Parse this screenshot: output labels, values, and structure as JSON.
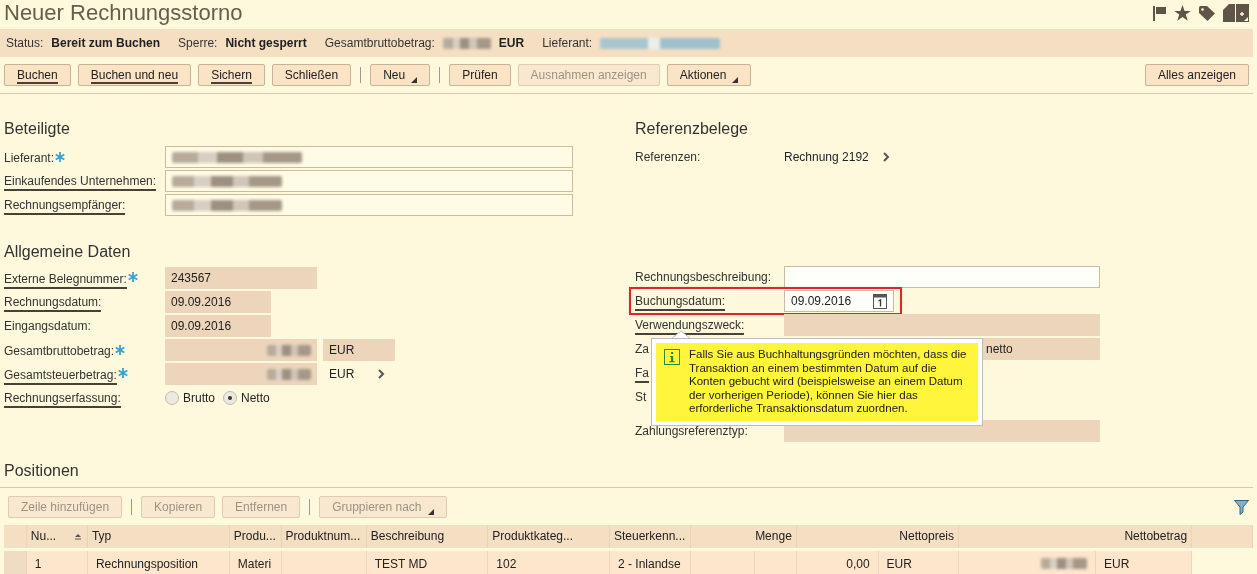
{
  "title": "Neuer Rechnungsstorno",
  "status_bar": [
    {
      "label": "Status:",
      "value": "Bereit zum Buchen",
      "blurred": false
    },
    {
      "label": "Sperre:",
      "value": "Nicht gesperrt",
      "blurred": false
    },
    {
      "label": "Gesamtbruttobetrag:",
      "value": "EUR",
      "blurred": true
    },
    {
      "label": "Lieferant:",
      "blurred": true
    }
  ],
  "toolbar": [
    {
      "kind": "button",
      "label": "Buchen",
      "underlined": true,
      "disabled": false
    },
    {
      "kind": "button",
      "label": "Buchen und neu",
      "underlined": true,
      "disabled": false
    },
    {
      "kind": "button",
      "label": "Sichern",
      "underlined": true,
      "disabled": false
    },
    {
      "kind": "button",
      "label": "Schließen",
      "underlined": false,
      "disabled": false
    },
    {
      "kind": "separator"
    },
    {
      "kind": "menu",
      "label": "Neu",
      "underlined": false,
      "disabled": false
    },
    {
      "kind": "separator"
    },
    {
      "kind": "button",
      "label": "Prüfen",
      "underlined": false,
      "disabled": false
    },
    {
      "kind": "button",
      "label": "Ausnahmen anzeigen",
      "underlined": false,
      "disabled": true
    },
    {
      "kind": "menu",
      "label": "Aktionen",
      "underlined": false,
      "disabled": false
    }
  ],
  "toolbar_right": {
    "label": "Alles anzeigen"
  },
  "beteiligte": {
    "title": "Beteiligte",
    "fields": [
      {
        "label": "Lieferant:",
        "required": true,
        "underlined": false
      },
      {
        "label": "Einkaufendes Unternehmen:",
        "required": false,
        "underlined": true
      },
      {
        "label": "Rechnungsempfänger:",
        "required": false,
        "underlined": true
      }
    ]
  },
  "allgemeine_daten": {
    "title": "Allgemeine Daten",
    "fields": [
      {
        "kind": "text",
        "label": "Externe Belegnummer:",
        "required": true,
        "underlined": true,
        "editable": false,
        "value": "243567"
      },
      {
        "kind": "date",
        "label": "Rechnungsdatum:",
        "required": false,
        "underlined": true,
        "editable": false,
        "value": "09.09.2016"
      },
      {
        "kind": "date",
        "label": "Eingangsdatum:",
        "required": false,
        "underlined": false,
        "editable": false,
        "value": "09.09.2016"
      },
      {
        "kind": "amount",
        "label": "Gesamtbruttobetrag:",
        "required": true,
        "underlined": false,
        "editable": false,
        "currency": "EUR",
        "currency_boxed": true,
        "has_details": false
      },
      {
        "kind": "amount",
        "label": "Gesamtsteuerbetrag:",
        "required": true,
        "underlined": true,
        "editable": false,
        "currency": "EUR",
        "currency_boxed": false,
        "has_details": true
      },
      {
        "kind": "radio",
        "label": "Rechnungserfassung:",
        "required": false,
        "underlined": true,
        "options": [
          {
            "label": "Brutto",
            "selected": false
          },
          {
            "label": "Netto",
            "selected": true
          }
        ]
      }
    ]
  },
  "referenzbelege": {
    "title": "Referenzbelege",
    "label": "Referenzen:",
    "value": "Rechnung 2192"
  },
  "right_fields": [
    {
      "kind": "text",
      "label": "Rechnungsbeschreibung:",
      "underlined": false,
      "editable": true,
      "highlighted": false
    },
    {
      "kind": "date",
      "label": "Buchungsdatum:",
      "underlined": true,
      "editable": true,
      "highlighted": true,
      "value": "09.09.2016"
    },
    {
      "kind": "text",
      "label": "Verwendungszweck:",
      "underlined": true,
      "editable": false,
      "highlighted": false
    },
    {
      "kind": "text",
      "label": "Za",
      "underlined": false,
      "editable": false,
      "highlighted": false,
      "covered": true,
      "value": "netto"
    },
    {
      "kind": "none",
      "label": "Fa",
      "underlined": true,
      "highlighted": false
    },
    {
      "kind": "none",
      "label": "St",
      "underlined": false,
      "highlighted": false
    },
    {
      "kind": "text",
      "label": "Zahlungsreferenztyp:",
      "underlined": false,
      "editable": false,
      "highlighted": false
    }
  ],
  "tooltip": {
    "text": "Falls Sie aus Buchhaltungsgründen möchten, dass die Transaktion an einem bestimmten Datum auf die Konten gebucht wird (beispielsweise an einem Datum der vorherigen Periode), können Sie hier das erforderliche Transaktionsdatum zuordnen."
  },
  "positionen": {
    "title": "Positionen",
    "toolbar": [
      {
        "kind": "button",
        "label": "Zeile hinzufügen",
        "disabled": true
      },
      {
        "kind": "separator"
      },
      {
        "kind": "button",
        "label": "Kopieren",
        "disabled": true
      },
      {
        "kind": "button",
        "label": "Entfernen",
        "disabled": true
      },
      {
        "kind": "separator"
      },
      {
        "kind": "menu",
        "label": "Gruppieren nach",
        "disabled": true
      }
    ],
    "table": {
      "columns": [
        {
          "label": "Nu...",
          "sorted": true
        },
        {
          "label": "Typ",
          "sorted": false
        },
        {
          "label": "Produ...",
          "sorted": false
        },
        {
          "label": "Produktnum...",
          "sorted": false
        },
        {
          "label": "Beschreibung",
          "sorted": false
        },
        {
          "label": "Produktkateg...",
          "sorted": false
        },
        {
          "label": "Steuerkenn...",
          "sorted": false
        },
        {
          "label": "Menge",
          "sorted": false
        },
        {
          "label": "Nettopreis",
          "sorted": false
        },
        {
          "label": "Nettobetrag",
          "sorted": false
        }
      ],
      "rows": [
        {
          "selected": false,
          "cells": [
            "1",
            "Rechnungsposition",
            "Materi",
            null,
            "TEST MD",
            "102",
            "2 - Inlandse",
            null,
            {
              "amount": "0,00",
              "currency": "EUR"
            },
            {
              "blurred": true,
              "currency": "EUR"
            }
          ]
        }
      ]
    }
  }
}
